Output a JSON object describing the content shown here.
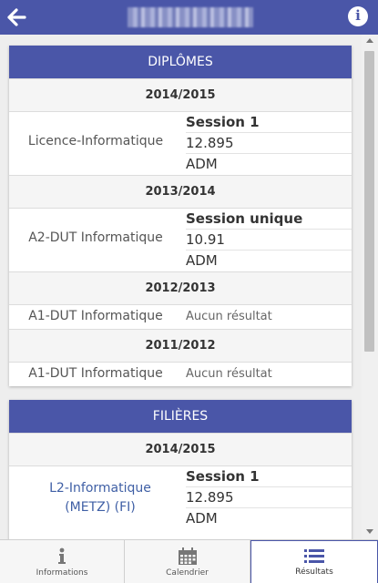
{
  "header": {
    "back_icon": "arrow-left-icon",
    "title": "(blurred name)",
    "info_icon": "info-icon"
  },
  "diplomes": {
    "title": "DIPLÔMES",
    "groups": [
      {
        "year": "2014/2015",
        "name": "Licence-Informatique",
        "session": "Session 1",
        "note": "12.895",
        "result": "ADM"
      },
      {
        "year": "2013/2014",
        "name": "A2-DUT Informatique",
        "session": "Session unique",
        "note": "10.91",
        "result": "ADM"
      },
      {
        "year": "2012/2013",
        "name": "A1-DUT Informatique",
        "none": "Aucun résultat"
      },
      {
        "year": "2011/2012",
        "name": "A1-DUT Informatique",
        "none": "Aucun résultat"
      }
    ]
  },
  "filieres": {
    "title": "FILIÈRES",
    "groups": [
      {
        "year": "2014/2015",
        "name": "L2-Informatique (METZ) (FI)",
        "session": "Session 1",
        "note": "12.895",
        "result": "ADM"
      }
    ]
  },
  "tabs": [
    {
      "label": "Informations",
      "icon": "info-icon",
      "active": false
    },
    {
      "label": "Calendrier",
      "icon": "calendar-icon",
      "active": false
    },
    {
      "label": "Résultats",
      "icon": "list-icon",
      "active": true
    }
  ],
  "colors": {
    "primary": "#4a56a8",
    "link": "#3f5fa5"
  }
}
